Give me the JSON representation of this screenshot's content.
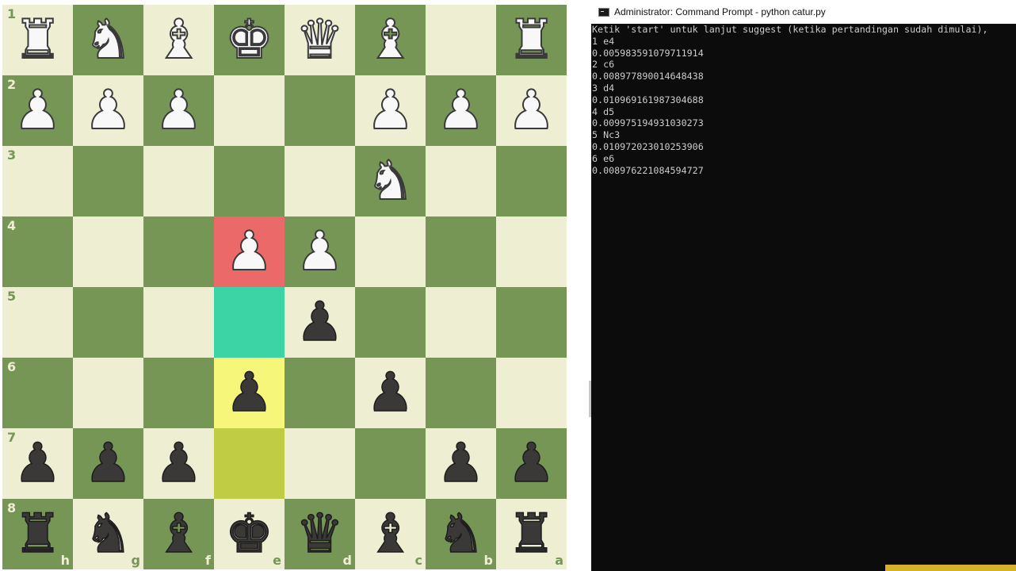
{
  "board": {
    "light_color": "#eeeed2",
    "dark_color": "#769656",
    "highlight_colors": {
      "red": "#eb6969",
      "teal": "#3cd3a5",
      "yellow": "#f6f67a",
      "olive": "#bfcc44"
    },
    "rank_labels": [
      "1",
      "2",
      "3",
      "4",
      "5",
      "6",
      "7",
      "8"
    ],
    "file_labels": [
      "h",
      "g",
      "f",
      "e",
      "d",
      "c",
      "b",
      "a"
    ],
    "highlights": [
      {
        "row": 3,
        "col": 3,
        "kind": "red"
      },
      {
        "row": 4,
        "col": 3,
        "kind": "teal"
      },
      {
        "row": 5,
        "col": 3,
        "kind": "yellow"
      },
      {
        "row": 6,
        "col": 3,
        "kind": "olive"
      }
    ],
    "pieces": [
      {
        "row": 0,
        "col": 0,
        "color": "white",
        "type": "rook",
        "glyph": "♜"
      },
      {
        "row": 0,
        "col": 1,
        "color": "white",
        "type": "knight",
        "glyph": "♞"
      },
      {
        "row": 0,
        "col": 2,
        "color": "white",
        "type": "bishop",
        "glyph": "♝"
      },
      {
        "row": 0,
        "col": 3,
        "color": "white",
        "type": "king",
        "glyph": "♚"
      },
      {
        "row": 0,
        "col": 4,
        "color": "white",
        "type": "queen",
        "glyph": "♛"
      },
      {
        "row": 0,
        "col": 5,
        "color": "white",
        "type": "bishop",
        "glyph": "♝"
      },
      {
        "row": 0,
        "col": 7,
        "color": "white",
        "type": "rook",
        "glyph": "♜"
      },
      {
        "row": 1,
        "col": 0,
        "color": "white",
        "type": "pawn",
        "glyph": "♟"
      },
      {
        "row": 1,
        "col": 1,
        "color": "white",
        "type": "pawn",
        "glyph": "♟"
      },
      {
        "row": 1,
        "col": 2,
        "color": "white",
        "type": "pawn",
        "glyph": "♟"
      },
      {
        "row": 1,
        "col": 5,
        "color": "white",
        "type": "pawn",
        "glyph": "♟"
      },
      {
        "row": 1,
        "col": 6,
        "color": "white",
        "type": "pawn",
        "glyph": "♟"
      },
      {
        "row": 1,
        "col": 7,
        "color": "white",
        "type": "pawn",
        "glyph": "♟"
      },
      {
        "row": 2,
        "col": 5,
        "color": "white",
        "type": "knight",
        "glyph": "♞"
      },
      {
        "row": 3,
        "col": 3,
        "color": "white",
        "type": "pawn",
        "glyph": "♟"
      },
      {
        "row": 3,
        "col": 4,
        "color": "white",
        "type": "pawn",
        "glyph": "♟"
      },
      {
        "row": 4,
        "col": 4,
        "color": "black",
        "type": "pawn",
        "glyph": "♟"
      },
      {
        "row": 5,
        "col": 3,
        "color": "black",
        "type": "pawn",
        "glyph": "♟"
      },
      {
        "row": 5,
        "col": 5,
        "color": "black",
        "type": "pawn",
        "glyph": "♟"
      },
      {
        "row": 6,
        "col": 0,
        "color": "black",
        "type": "pawn",
        "glyph": "♟"
      },
      {
        "row": 6,
        "col": 1,
        "color": "black",
        "type": "pawn",
        "glyph": "♟"
      },
      {
        "row": 6,
        "col": 2,
        "color": "black",
        "type": "pawn",
        "glyph": "♟"
      },
      {
        "row": 6,
        "col": 6,
        "color": "black",
        "type": "pawn",
        "glyph": "♟"
      },
      {
        "row": 6,
        "col": 7,
        "color": "black",
        "type": "pawn",
        "glyph": "♟"
      },
      {
        "row": 7,
        "col": 0,
        "color": "black",
        "type": "rook",
        "glyph": "♜"
      },
      {
        "row": 7,
        "col": 1,
        "color": "black",
        "type": "knight",
        "glyph": "♞"
      },
      {
        "row": 7,
        "col": 2,
        "color": "black",
        "type": "bishop",
        "glyph": "♝"
      },
      {
        "row": 7,
        "col": 3,
        "color": "black",
        "type": "king",
        "glyph": "♚"
      },
      {
        "row": 7,
        "col": 4,
        "color": "black",
        "type": "queen",
        "glyph": "♛"
      },
      {
        "row": 7,
        "col": 5,
        "color": "black",
        "type": "bishop",
        "glyph": "♝"
      },
      {
        "row": 7,
        "col": 6,
        "color": "black",
        "type": "knight",
        "glyph": "♞"
      },
      {
        "row": 7,
        "col": 7,
        "color": "black",
        "type": "rook",
        "glyph": "♜"
      }
    ]
  },
  "cmd": {
    "title": "Administrator: Command Prompt - python  catur.py",
    "icon": "cmd-icon",
    "background": "#0c0c0c",
    "text_color": "#cccccc",
    "lines": [
      "Ketik 'start' untuk lanjut suggest (ketika pertandingan sudah dimulai),",
      "1 e4",
      "0.005983591079711914",
      "2 c6",
      "0.008977890014648438",
      "3 d4",
      "0.010969161987304688",
      "4 d5",
      "0.009975194931030273",
      "5 Nc3",
      "0.010972023010253906",
      "6 e6",
      "0.008976221084594727"
    ]
  }
}
